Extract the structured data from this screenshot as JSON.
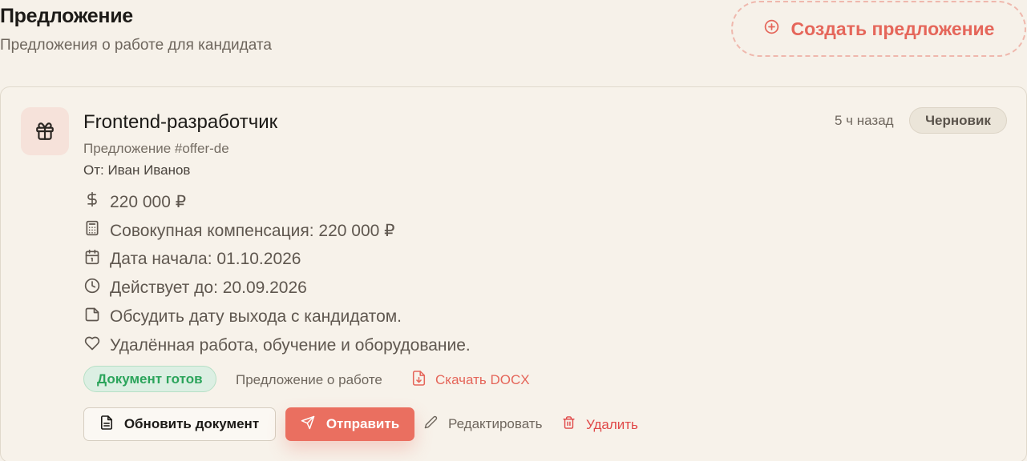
{
  "header": {
    "title": "Предложение",
    "subtitle": "Предложения о работе для кандидата",
    "create_label": "Создать предложение"
  },
  "offer": {
    "title": "Frontend-разработчик",
    "id_line": "Предложение #offer-de",
    "from_line": "От: Иван Иванов",
    "time_ago": "5 ч назад",
    "status": "Черновик",
    "details": [
      {
        "icon": "dollar-icon",
        "text": "220 000 ₽"
      },
      {
        "icon": "calculator-icon",
        "text": "Совокупная компенсация: 220 000 ₽"
      },
      {
        "icon": "calendar-icon",
        "text": "Дата начала: 01.10.2026"
      },
      {
        "icon": "clock-icon",
        "text": "Действует до: 20.09.2026"
      },
      {
        "icon": "sticky-note-icon",
        "text": "Обсудить дату выхода с кандидатом."
      },
      {
        "icon": "heart-icon",
        "text": "Удалённая работа, обучение и оборудование."
      }
    ],
    "doc_status": "Документ готов",
    "doc_type": "Предложение о работе",
    "download_label": "Скачать DOCX"
  },
  "actions": {
    "refresh_label": "Обновить документ",
    "send_label": "Отправить",
    "edit_label": "Редактировать",
    "delete_label": "Удалить"
  },
  "colors": {
    "background": "#f6f1e9",
    "accent": "#ea6f60",
    "success": "#2ba45b",
    "danger": "#e04848"
  }
}
